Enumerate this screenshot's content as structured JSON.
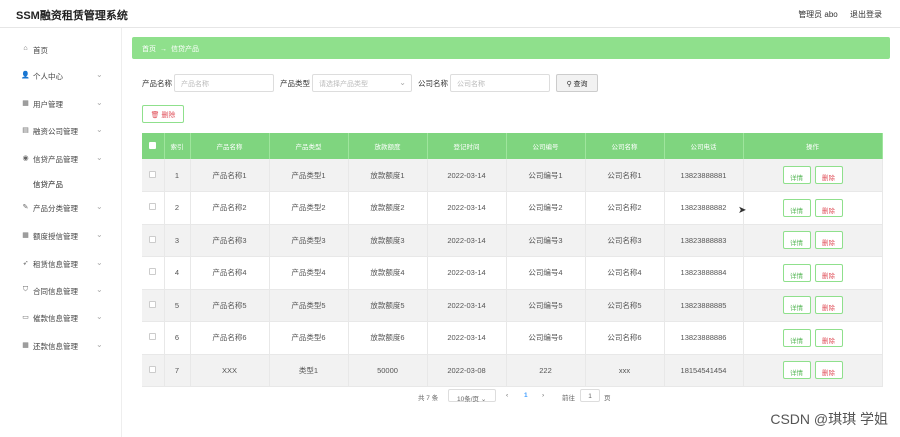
{
  "header": {
    "brand": "SSM融资租赁管理系统",
    "user": "管理员 abo",
    "logout": "退出登录"
  },
  "sidebar": {
    "items": [
      {
        "label": "首页",
        "icon": "home-icon",
        "glyph": "⌂",
        "has_arrow": false
      },
      {
        "label": "个人中心",
        "icon": "user-icon",
        "glyph": "👤",
        "has_arrow": true
      },
      {
        "label": "用户管理",
        "icon": "grid-icon",
        "glyph": "▦",
        "has_arrow": true
      },
      {
        "label": "融资公司管理",
        "icon": "building-icon",
        "glyph": "▤",
        "has_arrow": true
      },
      {
        "label": "信贷产品管理",
        "icon": "location-icon",
        "glyph": "◉",
        "has_arrow": true
      },
      {
        "label": "产品分类管理",
        "icon": "tag-icon",
        "glyph": "✎",
        "has_arrow": true
      },
      {
        "label": "额度授信管理",
        "icon": "grid-icon",
        "glyph": "▦",
        "has_arrow": true
      },
      {
        "label": "租赁信息管理",
        "icon": "send-icon",
        "glyph": "➶",
        "has_arrow": true
      },
      {
        "label": "合同信息管理",
        "icon": "shield-icon",
        "glyph": "⛉",
        "has_arrow": true
      },
      {
        "label": "催款信息管理",
        "icon": "folder-icon",
        "glyph": "▭",
        "has_arrow": true
      },
      {
        "label": "还款信息管理",
        "icon": "grid-icon",
        "glyph": "▦",
        "has_arrow": true
      }
    ],
    "submenu": "信贷产品"
  },
  "breadcrumb": {
    "home": "首页",
    "separator": "→",
    "current": "信贷产品"
  },
  "search": {
    "product_name_label": "产品名称",
    "product_name_placeholder": "产品名称",
    "product_type_label": "产品类型",
    "product_type_placeholder": "请选择产品类型",
    "company_name_label": "公司名称",
    "company_name_placeholder": "公司名称",
    "search_button": "查询"
  },
  "toolbar": {
    "delete_button": "删除"
  },
  "table": {
    "headers": [
      "索引",
      "产品名称",
      "产品类型",
      "放款额度",
      "登记时间",
      "公司编号",
      "公司名称",
      "公司电话",
      "操作"
    ],
    "detail_label": "详情",
    "delete_label": "删除",
    "rows": [
      [
        "1",
        "产品名称1",
        "产品类型1",
        "放款额度1",
        "2022-03-14",
        "公司编号1",
        "公司名称1",
        "13823888881"
      ],
      [
        "2",
        "产品名称2",
        "产品类型2",
        "放款额度2",
        "2022-03-14",
        "公司编号2",
        "公司名称2",
        "13823888882"
      ],
      [
        "3",
        "产品名称3",
        "产品类型3",
        "放款额度3",
        "2022-03-14",
        "公司编号3",
        "公司名称3",
        "13823888883"
      ],
      [
        "4",
        "产品名称4",
        "产品类型4",
        "放款额度4",
        "2022-03-14",
        "公司编号4",
        "公司名称4",
        "13823888884"
      ],
      [
        "5",
        "产品名称5",
        "产品类型5",
        "放款额度5",
        "2022-03-14",
        "公司编号5",
        "公司名称5",
        "13823888885"
      ],
      [
        "6",
        "产品名称6",
        "产品类型6",
        "放款额度6",
        "2022-03-14",
        "公司编号6",
        "公司名称6",
        "13823888886"
      ],
      [
        "7",
        "XXX",
        "类型1",
        "50000",
        "2022-03-08",
        "222",
        "xxx",
        "18154541454"
      ]
    ]
  },
  "pagination": {
    "total": "共 7 条",
    "page_size": "10条/页",
    "current_page": "1",
    "goto_label": "前往",
    "goto_value": "1",
    "page_unit": "页"
  },
  "watermark": "CSDN @琪琪 学姐"
}
